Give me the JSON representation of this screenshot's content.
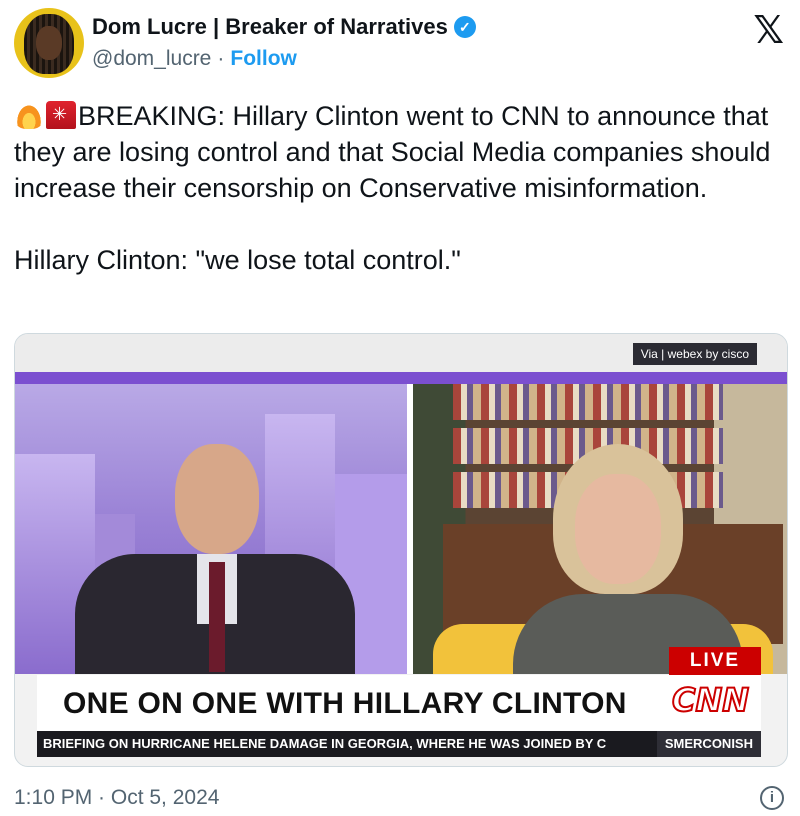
{
  "author": {
    "name": "Dom Lucre | Breaker of Narratives",
    "handle": "@dom_lucre",
    "separator": "·",
    "follow_label": "Follow",
    "verified_icon": "verified-badge-icon",
    "verified_color": "#1d9bf0"
  },
  "platform_logo": "𝕏",
  "tweet": {
    "emoji_1": "fire-emoji",
    "emoji_2": "siren-emoji",
    "text": "BREAKING: Hillary Clinton went to CNN to announce that they are losing control and that Social Media companies should increase their censorship on Conservative misinformation.\n\nHillary Clinton: \"we lose total control.\""
  },
  "media": {
    "watermark": "Via | webex by cisco",
    "live_label": "LIVE",
    "chyron_title": "ONE ON ONE WITH HILLARY CLINTON",
    "network_logo": "CNN",
    "ticker_text": "BRIEFING ON HURRICANE HELENE DAMAGE IN GEORGIA, WHERE HE WAS JOINED BY C",
    "ticker_tag": "SMERCONISH"
  },
  "timestamp": "1:10 PM · Oct 5, 2024",
  "colors": {
    "accent": "#1d9bf0",
    "text": "#0f1419",
    "muted": "#536471",
    "cnn_red": "#cc0000"
  }
}
